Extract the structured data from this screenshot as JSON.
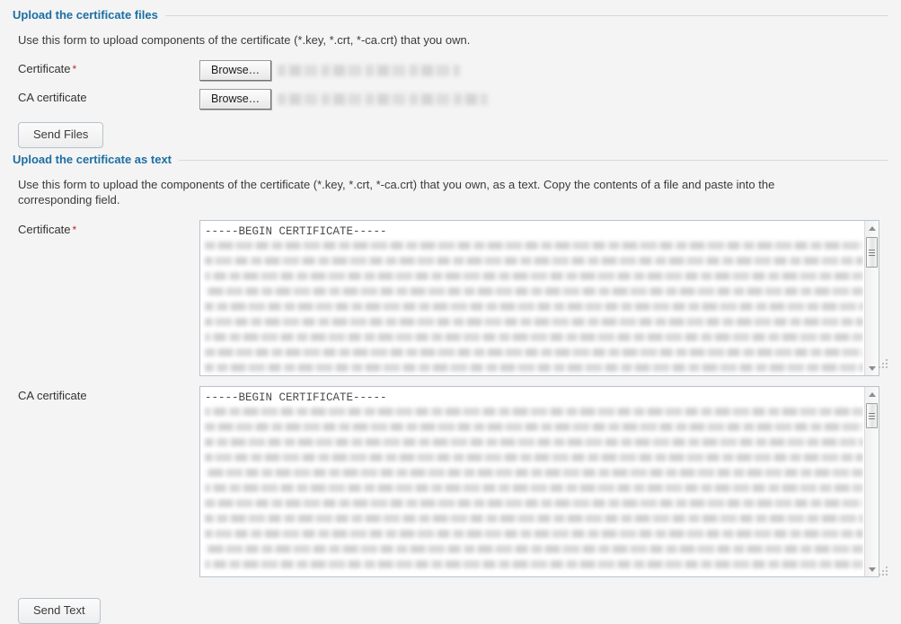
{
  "colors": {
    "page_background": "#f4f4f4",
    "legend_accent": "#1c6ea4",
    "required_star": "#cc2222",
    "field_border": "#b9c3cc",
    "text": "#333333"
  },
  "sections": {
    "files": {
      "legend": "Upload the certificate files",
      "description": "Use this form to upload components of the certificate (*.key, *.crt, *-ca.crt) that you own.",
      "rows": [
        {
          "label": "Certificate",
          "required": true,
          "required_marker": "*",
          "browse_label": "Browse…",
          "filename": "",
          "filename_redacted": true
        },
        {
          "label": "CA certificate",
          "required": false,
          "required_marker": "",
          "browse_label": "Browse…",
          "filename": "",
          "filename_redacted": true
        }
      ],
      "submit_label": "Send Files"
    },
    "text": {
      "legend": "Upload the certificate as text",
      "description": "Use this form to upload the components of the certificate (*.key, *.crt, *-ca.crt) that you own, as a text. Copy the contents of a file and paste into the corresponding field.",
      "rows": [
        {
          "label": "Certificate",
          "required": true,
          "required_marker": "*",
          "value_first_line": "-----BEGIN CERTIFICATE-----",
          "body_redacted": true,
          "scrollbar": {
            "up_arrow": "scroll-up",
            "down_arrow": "scroll-down"
          }
        },
        {
          "label": "CA certificate",
          "required": false,
          "required_marker": "",
          "value_first_line": "-----BEGIN CERTIFICATE-----",
          "body_redacted": true,
          "scrollbar": {
            "up_arrow": "scroll-up",
            "down_arrow": "scroll-down"
          }
        }
      ],
      "submit_label": "Send Text"
    }
  }
}
